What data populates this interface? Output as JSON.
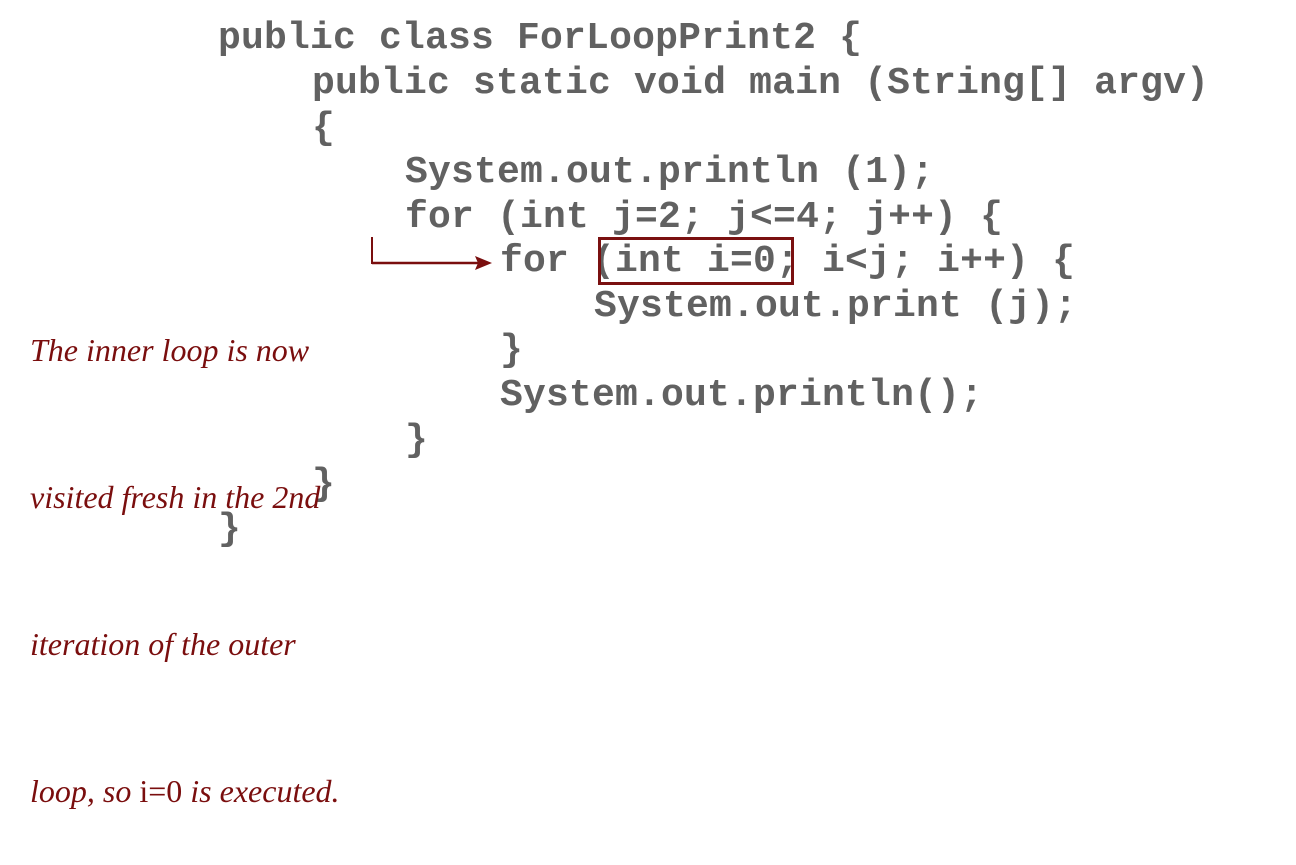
{
  "code": {
    "lines": [
      "public class ForLoopPrint2 {",
      "public static void main (String[] argv)",
      "{",
      "System.out.println (1);",
      "for (int j=2; j<=4; j++) {",
      "for (int i=0; i<j; i++) {",
      "System.out.print (j);",
      "}",
      "System.out.println();",
      "}",
      "}",
      "}"
    ],
    "highlighted_text": "(int i=0;"
  },
  "annotation": {
    "line1": "The inner loop is now",
    "line2": "visited fresh in the 2nd",
    "line3": "iteration of the outer",
    "line4_prefix": "loop, so ",
    "line4_code": "i=0",
    "line4_suffix": " is executed."
  },
  "colors": {
    "code_text": "#616161",
    "annotation_text": "#7a0e0e",
    "highlight_border": "#7a1010",
    "arrow": "#7a0e0e"
  }
}
